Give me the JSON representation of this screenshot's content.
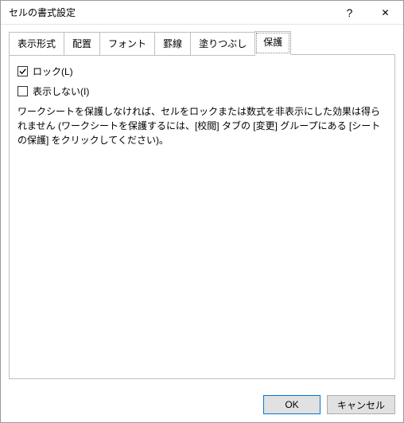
{
  "window": {
    "title": "セルの書式設定"
  },
  "tabs": {
    "display": "表示形式",
    "alignment": "配置",
    "font": "フォント",
    "border": "罫線",
    "fill": "塗りつぶし",
    "protection": "保護"
  },
  "protection": {
    "lock_label": "ロック(L)",
    "lock_checked": true,
    "hide_label": "表示しない(I)",
    "hide_checked": false,
    "description": "ワークシートを保護しなければ、セルをロックまたは数式を非表示にした効果は得られません (ワークシートを保護するには、[校閲] タブの [変更] グループにある [シートの保護] をクリックしてください)。"
  },
  "buttons": {
    "ok": "OK",
    "cancel": "キャンセル"
  },
  "icons": {
    "help": "?",
    "close": "✕"
  }
}
